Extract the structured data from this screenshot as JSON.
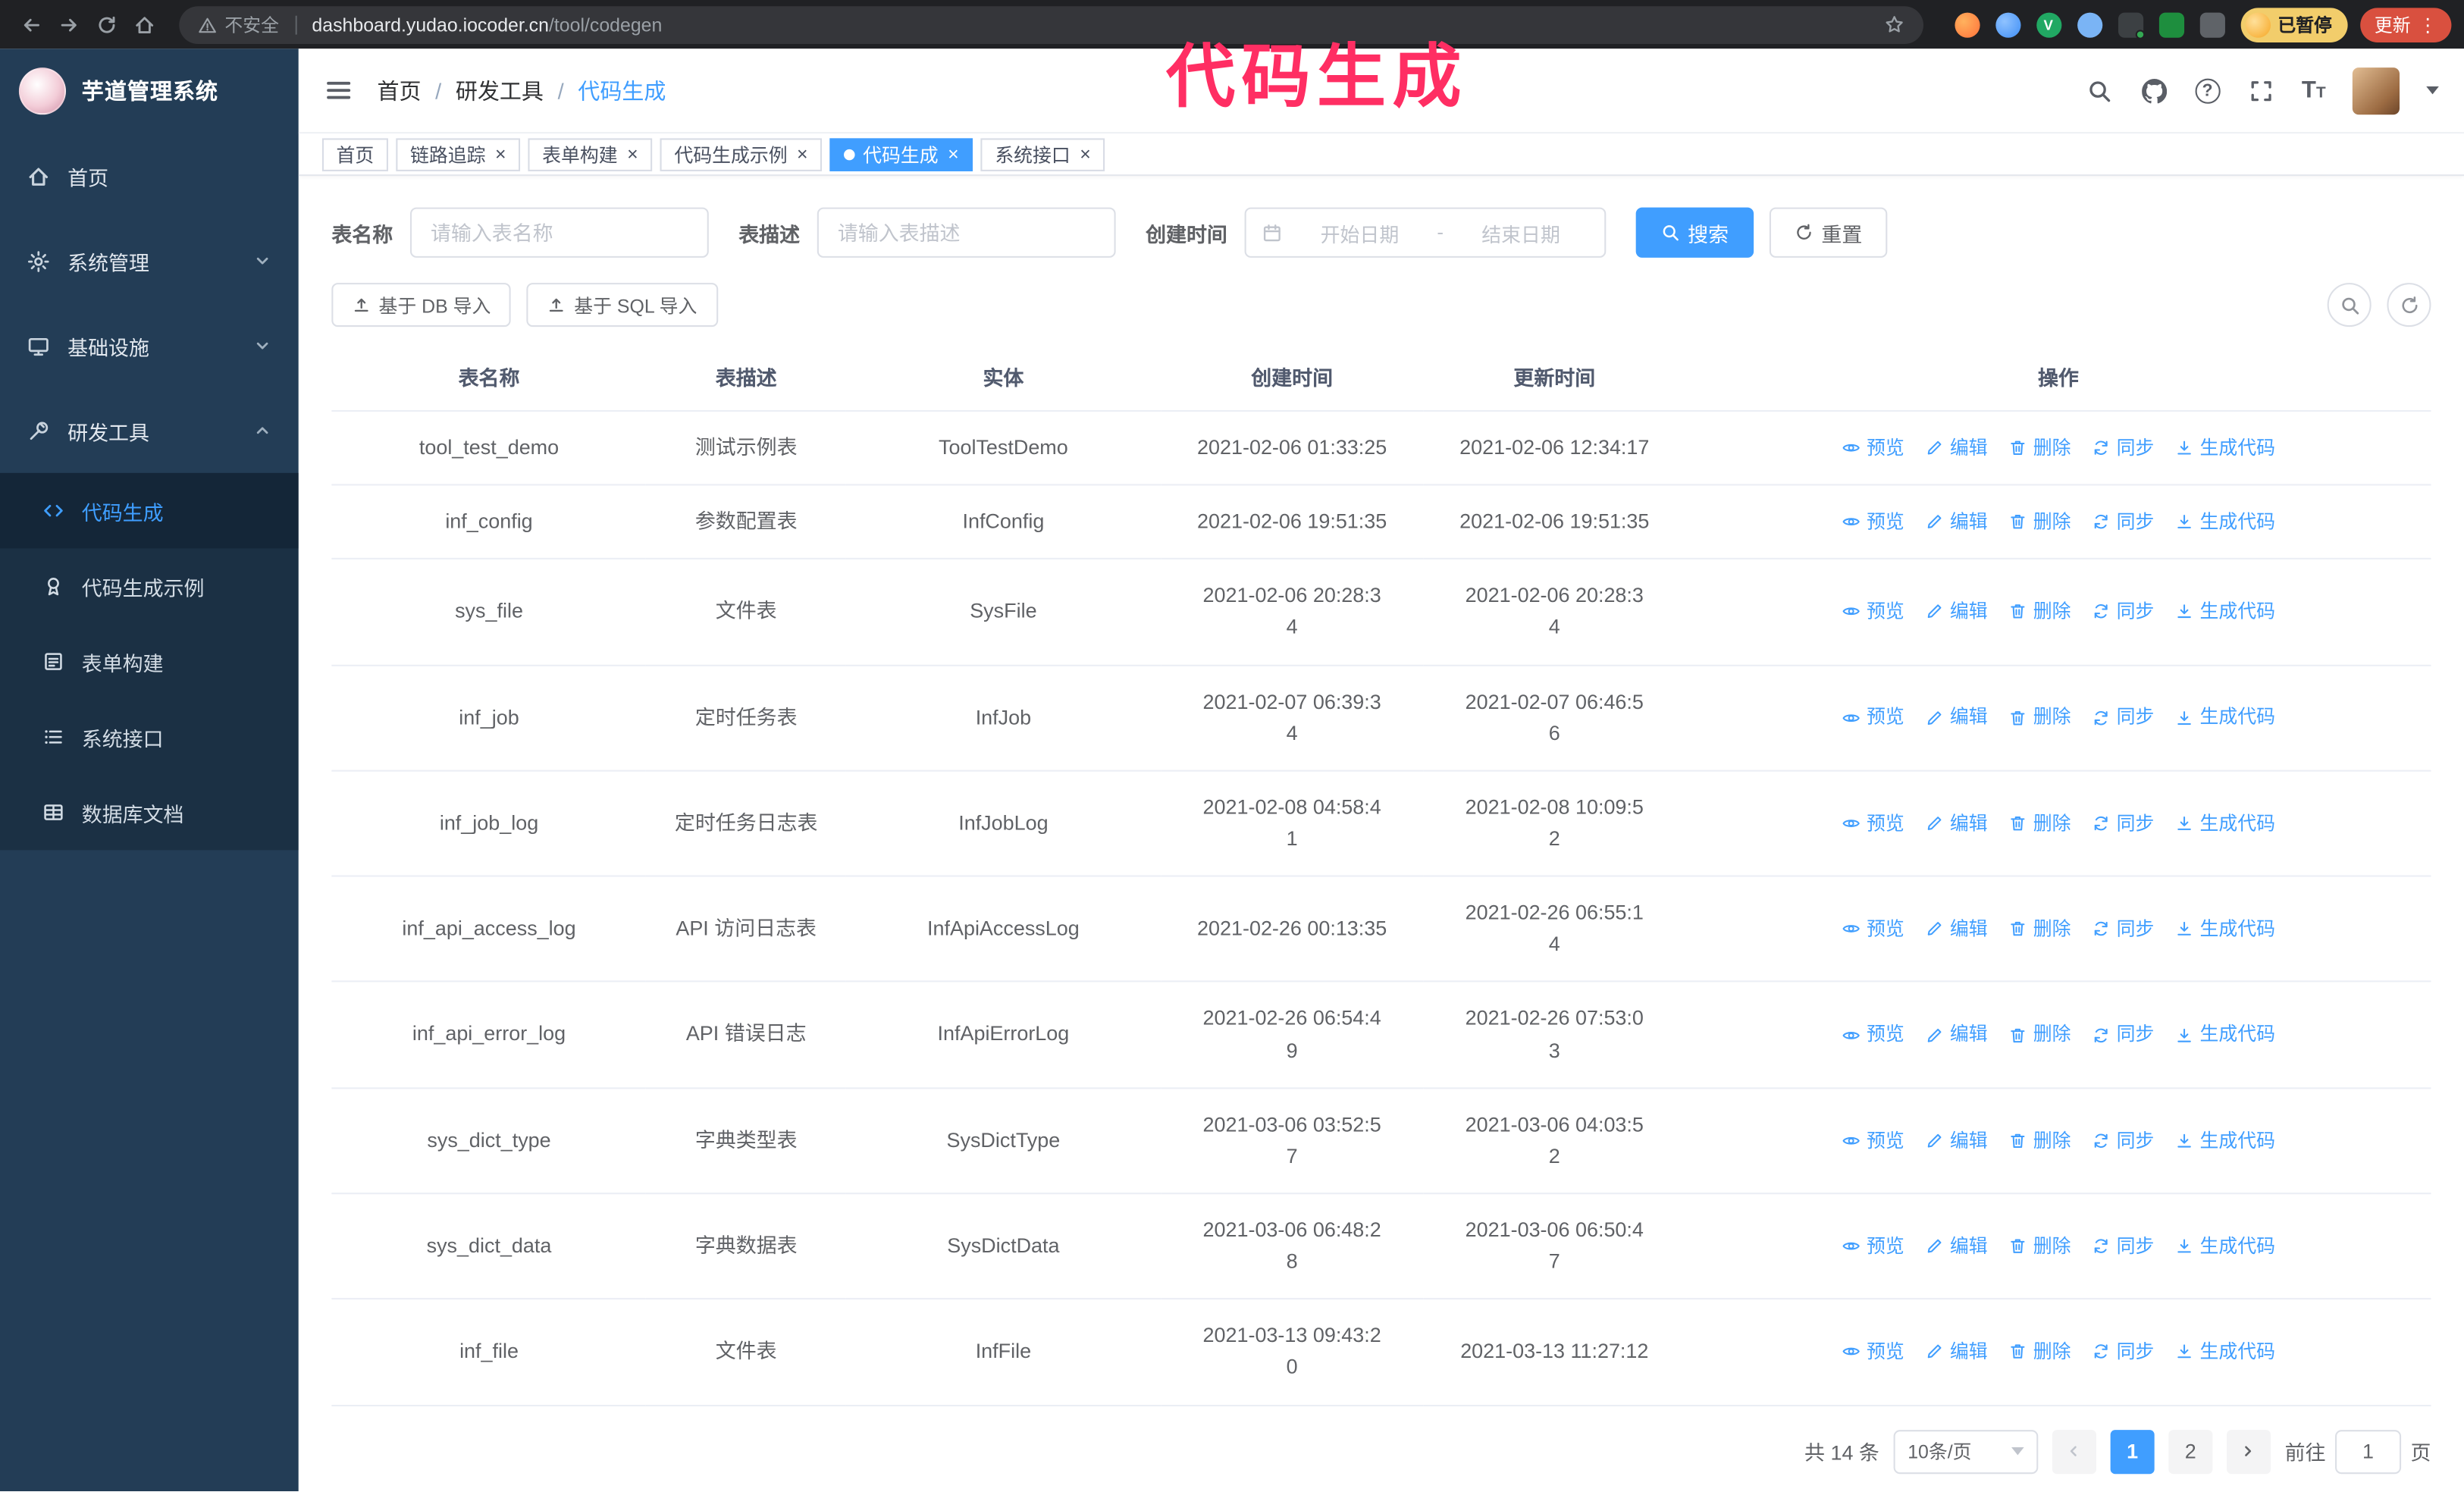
{
  "browser": {
    "security_label": "不安全",
    "url_host": "dashboard.yudao.iocoder.cn",
    "url_path": "/tool/codegen",
    "paused_badge": "已暂停",
    "update_label": "更新"
  },
  "annotation": "代码生成",
  "sidebar": {
    "logo_title": "芋道管理系统",
    "items": [
      {
        "label": "首页",
        "icon": "home-icon"
      },
      {
        "label": "系统管理",
        "icon": "gear-icon",
        "chevron": "down"
      },
      {
        "label": "基础设施",
        "icon": "monitor-icon",
        "chevron": "down"
      },
      {
        "label": "研发工具",
        "icon": "wrench-icon",
        "chevron": "up"
      }
    ],
    "subitems": [
      {
        "label": "代码生成",
        "icon": "code-icon",
        "active": true
      },
      {
        "label": "代码生成示例",
        "icon": "medal-icon"
      },
      {
        "label": "表单构建",
        "icon": "form-icon"
      },
      {
        "label": "系统接口",
        "icon": "api-icon"
      },
      {
        "label": "数据库文档",
        "icon": "grid-icon"
      }
    ]
  },
  "header": {
    "breadcrumb": [
      "首页",
      "研发工具",
      "代码生成"
    ],
    "separator": "/"
  },
  "tabs": [
    {
      "label": "首页",
      "closable": false,
      "active": false
    },
    {
      "label": "链路追踪",
      "closable": true,
      "active": false
    },
    {
      "label": "表单构建",
      "closable": true,
      "active": false
    },
    {
      "label": "代码生成示例",
      "closable": true,
      "active": false
    },
    {
      "label": "代码生成",
      "closable": true,
      "active": true
    },
    {
      "label": "系统接口",
      "closable": true,
      "active": false
    }
  ],
  "filters": {
    "table_name_label": "表名称",
    "table_name_placeholder": "请输入表名称",
    "table_desc_label": "表描述",
    "table_desc_placeholder": "请输入表描述",
    "create_time_label": "创建时间",
    "date_start_placeholder": "开始日期",
    "date_separator": "-",
    "date_end_placeholder": "结束日期",
    "search_label": "搜索",
    "reset_label": "重置"
  },
  "toolbar": {
    "db_import_label": "基于 DB 导入",
    "sql_import_label": "基于 SQL 导入"
  },
  "table": {
    "columns": [
      "表名称",
      "表描述",
      "实体",
      "创建时间",
      "更新时间",
      "操作"
    ],
    "actions": [
      {
        "label": "预览",
        "icon": "eye-icon"
      },
      {
        "label": "编辑",
        "icon": "edit-icon"
      },
      {
        "label": "删除",
        "icon": "delete-icon"
      },
      {
        "label": "同步",
        "icon": "sync-icon"
      },
      {
        "label": "生成代码",
        "icon": "download-icon"
      }
    ],
    "rows": [
      {
        "name": "tool_test_demo",
        "desc": "测试示例表",
        "entity": "ToolTestDemo",
        "created": "2021-02-06 01:33:25",
        "updated": "2021-02-06 12:34:17"
      },
      {
        "name": "inf_config",
        "desc": "参数配置表",
        "entity": "InfConfig",
        "created": "2021-02-06 19:51:35",
        "updated": "2021-02-06 19:51:35"
      },
      {
        "name": "sys_file",
        "desc": "文件表",
        "entity": "SysFile",
        "created": "2021-02-06 20:28:3\n4",
        "updated": "2021-02-06 20:28:3\n4"
      },
      {
        "name": "inf_job",
        "desc": "定时任务表",
        "entity": "InfJob",
        "created": "2021-02-07 06:39:3\n4",
        "updated": "2021-02-07 06:46:5\n6"
      },
      {
        "name": "inf_job_log",
        "desc": "定时任务日志表",
        "entity": "InfJobLog",
        "created": "2021-02-08 04:58:4\n1",
        "updated": "2021-02-08 10:09:5\n2"
      },
      {
        "name": "inf_api_access_log",
        "desc": "API 访问日志表",
        "entity": "InfApiAccessLog",
        "created": "2021-02-26 00:13:35",
        "updated": "2021-02-26 06:55:1\n4"
      },
      {
        "name": "inf_api_error_log",
        "desc": "API 错误日志",
        "entity": "InfApiErrorLog",
        "created": "2021-02-26 06:54:4\n9",
        "updated": "2021-02-26 07:53:0\n3"
      },
      {
        "name": "sys_dict_type",
        "desc": "字典类型表",
        "entity": "SysDictType",
        "created": "2021-03-06 03:52:5\n7",
        "updated": "2021-03-06 04:03:5\n2"
      },
      {
        "name": "sys_dict_data",
        "desc": "字典数据表",
        "entity": "SysDictData",
        "created": "2021-03-06 06:48:2\n8",
        "updated": "2021-03-06 06:50:4\n7"
      },
      {
        "name": "inf_file",
        "desc": "文件表",
        "entity": "InfFile",
        "created": "2021-03-13 09:43:2\n0",
        "updated": "2021-03-13 11:27:12"
      }
    ]
  },
  "pagination": {
    "total_text": "共 14 条",
    "page_size_text": "10条/页",
    "pages": [
      "1",
      "2"
    ],
    "current_page": "1",
    "jump_prefix": "前往",
    "jump_value": "1",
    "jump_suffix": "页"
  },
  "colors": {
    "accent": "#409eff",
    "annotation": "#ff2e63",
    "sidebar_bg": "#233d56",
    "chrome_bg": "#202124"
  }
}
